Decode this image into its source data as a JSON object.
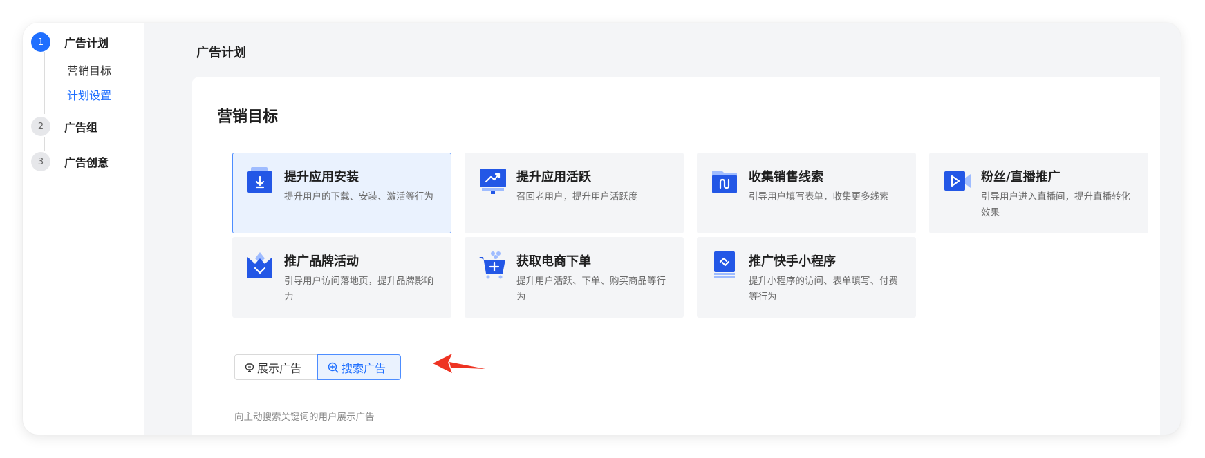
{
  "steps": [
    {
      "number": "1",
      "label": "广告计划"
    },
    {
      "number": "2",
      "label": "广告组"
    },
    {
      "number": "3",
      "label": "广告创意"
    }
  ],
  "substeps": [
    "营销目标",
    "计划设置"
  ],
  "page_title": "广告计划",
  "section_title": "营销目标",
  "cards": [
    {
      "title": "提升应用安装",
      "desc": "提升用户的下载、安装、激活等行为",
      "icon": "app-install-icon"
    },
    {
      "title": "提升应用活跃",
      "desc": "召回老用户，提升用户活跃度",
      "icon": "app-activity-icon"
    },
    {
      "title": "收集销售线索",
      "desc": "引导用户填写表单，收集更多线索",
      "icon": "sales-lead-icon"
    },
    {
      "title": "粉丝/直播推广",
      "desc": "引导用户进入直播间，提升直播转化效果",
      "icon": "live-stream-icon"
    },
    {
      "title": "推广品牌活动",
      "desc": "引导用户访问落地页，提升品牌影响力",
      "icon": "brand-crown-icon"
    },
    {
      "title": "获取电商下单",
      "desc": "提升用户活跃、下单、购买商品等行为",
      "icon": "shopping-cart-icon"
    },
    {
      "title": "推广快手小程序",
      "desc": "提升小程序的访问、表单填写、付费等行为",
      "icon": "mini-program-icon"
    }
  ],
  "ad_type": {
    "display_label": "展示广告",
    "search_label": "搜索广告",
    "selected": "搜索广告",
    "hint": "向主动搜索关键词的用户展示广告"
  },
  "colors": {
    "accent": "#1f6fff",
    "selected_bg": "#eaf2fe",
    "arrow": "#ee3322"
  }
}
